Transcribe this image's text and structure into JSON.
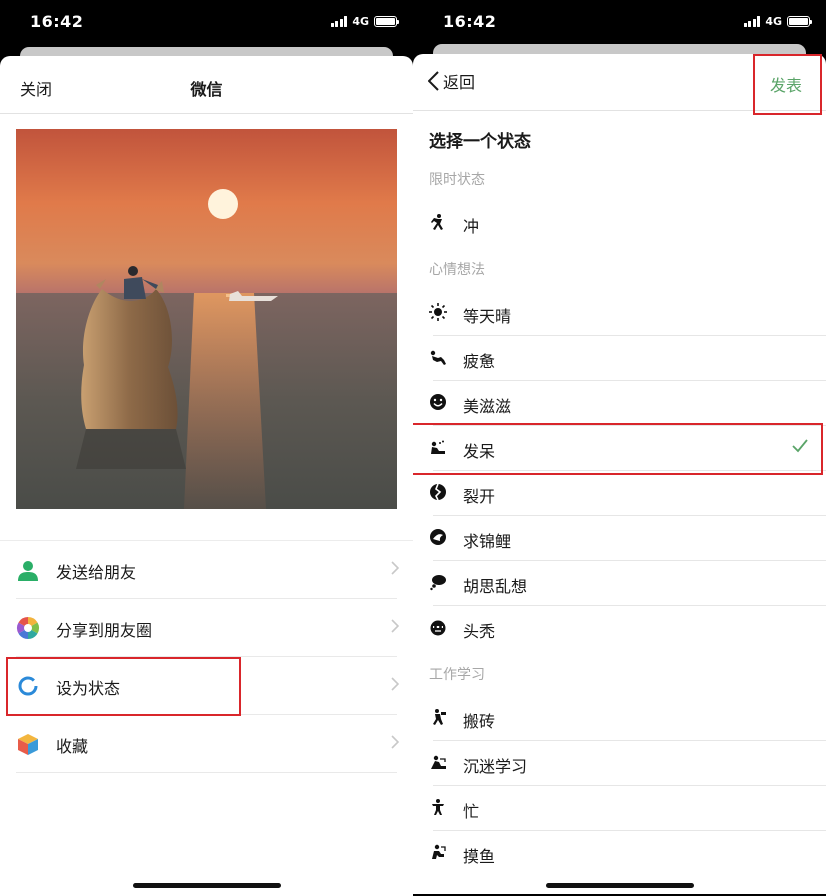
{
  "left": {
    "status_bar": {
      "time": "16:42",
      "network": "4G"
    },
    "nav": {
      "close": "关闭",
      "title": "微信"
    },
    "share_items": [
      {
        "label": "发送给朋友",
        "icon": "friend-icon"
      },
      {
        "label": "分享到朋友圈",
        "icon": "moments-icon"
      },
      {
        "label": "设为状态",
        "icon": "status-ring-icon"
      },
      {
        "label": "收藏",
        "icon": "favorites-cube-icon"
      }
    ]
  },
  "right": {
    "status_bar": {
      "time": "16:42",
      "network": "4G"
    },
    "nav": {
      "back": "返回",
      "publish": "发表"
    },
    "heading": "选择一个状态",
    "groups": [
      {
        "title": "限时状态",
        "items": [
          {
            "label": "冲",
            "icon": "rush-icon"
          }
        ]
      },
      {
        "title": "心情想法",
        "items": [
          {
            "label": "等天晴",
            "icon": "sun-icon"
          },
          {
            "label": "疲惫",
            "icon": "tired-icon"
          },
          {
            "label": "美滋滋",
            "icon": "smile-icon"
          },
          {
            "label": "发呆",
            "icon": "daze-icon",
            "selected": true
          },
          {
            "label": "裂开",
            "icon": "cracked-icon"
          },
          {
            "label": "求锦鲤",
            "icon": "koi-icon"
          },
          {
            "label": "胡思乱想",
            "icon": "thought-bubble-icon"
          },
          {
            "label": "头秃",
            "icon": "bald-head-icon"
          }
        ]
      },
      {
        "title": "工作学习",
        "items": [
          {
            "label": "搬砖",
            "icon": "brick-worker-icon"
          },
          {
            "label": "沉迷学习",
            "icon": "study-icon"
          },
          {
            "label": "忙",
            "icon": "busy-icon"
          },
          {
            "label": "摸鱼",
            "icon": "slacking-icon"
          }
        ]
      }
    ]
  },
  "colors": {
    "accent_green": "#5aa468",
    "highlight_red": "#d9262b",
    "check_green": "#5aa468"
  }
}
